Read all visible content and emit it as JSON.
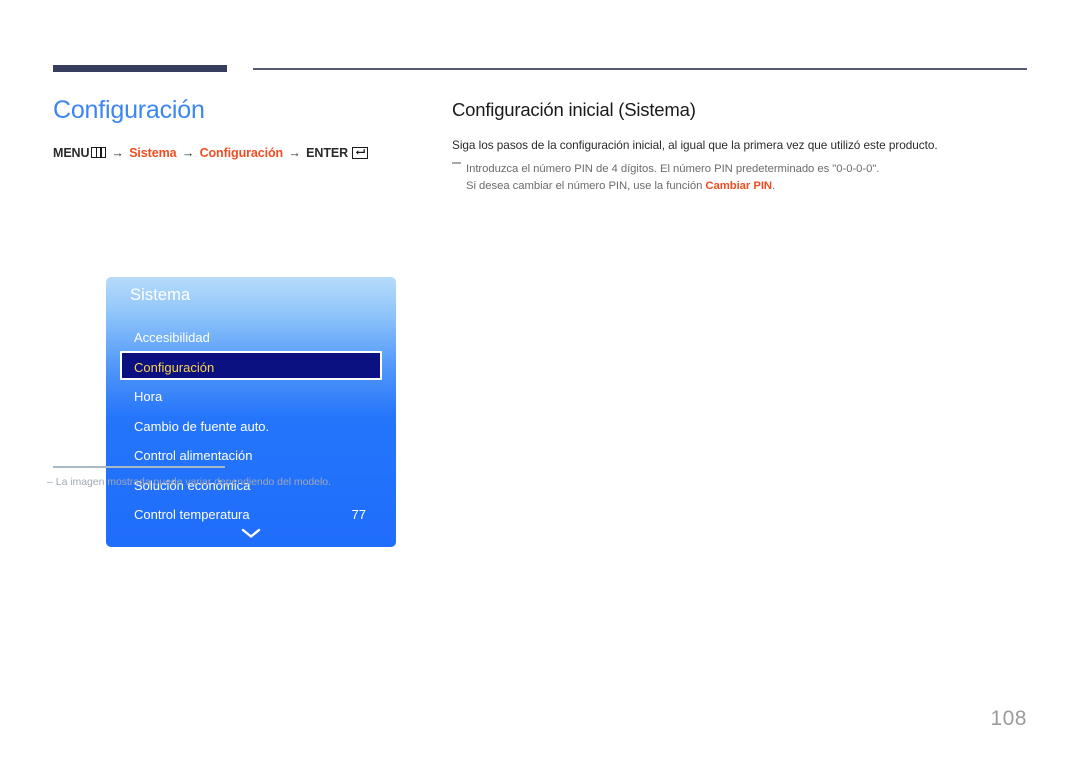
{
  "header": {
    "rule_thick": "thick-navy-bar",
    "rule_thin": "thin-navy-rule"
  },
  "left": {
    "title": "Configuración",
    "breadcrumb": {
      "menu_label": "MENU",
      "menu_icon": "menu-grid-icon",
      "arrow": "→",
      "crumb1": "Sistema",
      "crumb2": "Configuración",
      "enter_label": "ENTER",
      "enter_icon": "enter-return-icon"
    },
    "osd": {
      "header": "Sistema",
      "items": [
        {
          "label": "Accesibilidad",
          "value": "",
          "selected": false
        },
        {
          "label": "Configuración",
          "value": "",
          "selected": true
        },
        {
          "label": "Hora",
          "value": "",
          "selected": false
        },
        {
          "label": "Cambio de fuente auto.",
          "value": "",
          "selected": false
        },
        {
          "label": "Control alimentación",
          "value": "",
          "selected": false
        },
        {
          "label": "Solución económica",
          "value": "",
          "selected": false
        },
        {
          "label": "Control temperatura",
          "value": "77",
          "selected": false
        }
      ],
      "scroll_icon": "chevron-down-icon"
    },
    "footnote": {
      "dash": "‒",
      "text": "La imagen mostrada puede variar dependiendo del modelo."
    }
  },
  "right": {
    "section_title": "Configuración inicial (Sistema)",
    "lead": "Siga los pasos de la configuración inicial, al igual que la primera vez que utilizó este producto.",
    "note": {
      "line1": "Introduzca el número PIN de 4 dígitos. El número PIN predeterminado es \"0-0-0-0\".",
      "line2_before": "Si desea cambiar el número PIN, use la función ",
      "line2_accent": "Cambiar PIN",
      "line2_after": "."
    }
  },
  "footer": {
    "page_number": "108"
  },
  "colors": {
    "title_blue": "#3c86ef",
    "accent_orange": "#ef4e23",
    "rule_navy": "#373d5c",
    "osd_blue": "#1f6dfb",
    "osd_selected_bg": "#0b1180",
    "osd_selected_text": "#fbd24a",
    "note_gray": "#6c6c6c",
    "page_num_gray": "#9b9b9b"
  }
}
